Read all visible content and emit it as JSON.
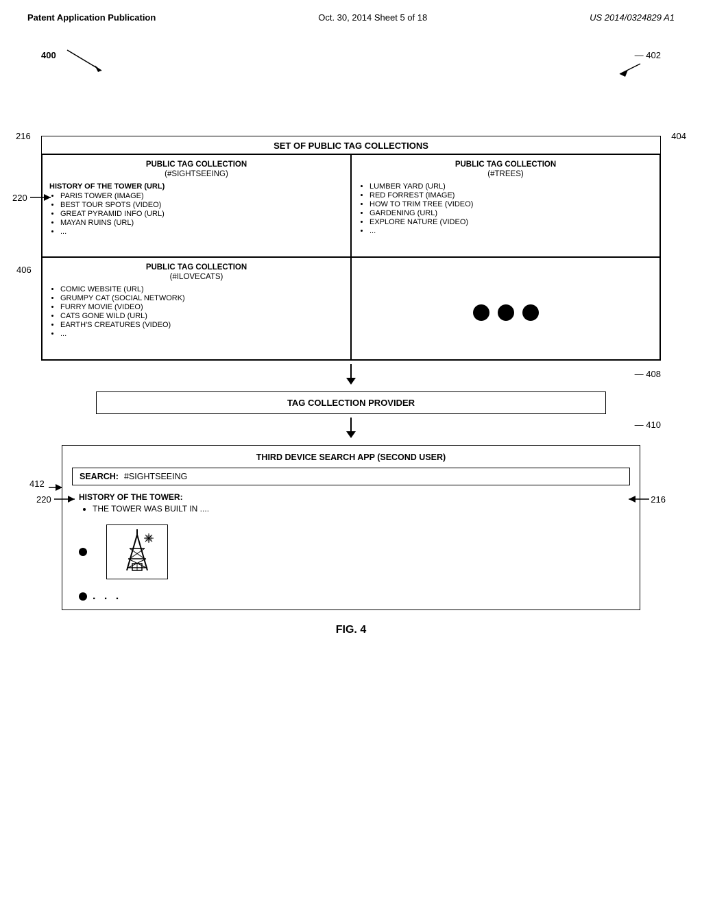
{
  "header": {
    "left": "Patent Application Publication",
    "center": "Oct. 30, 2014   Sheet 5 of 18",
    "right": "US 2014/0324829 A1"
  },
  "diagram": {
    "label_400": "400",
    "label_402": "402",
    "label_216_outer": "216",
    "label_404": "404",
    "label_406": "406",
    "label_408": "408",
    "label_410": "410",
    "label_412": "412",
    "label_220_result": "220",
    "label_216_result": "216",
    "outer_box_title": "SET OF PUBLIC TAG COLLECTIONS",
    "tag_collection_1": {
      "title": "PUBLIC TAG COLLECTION",
      "subtitle": "(#SIGHTSEEING)",
      "label_220": "220",
      "first_item": "HISTORY OF THE TOWER (URL)",
      "items": [
        "PARIS TOWER (IMAGE)",
        "BEST TOUR SPOTS (VIDEO)",
        "GREAT PYRAMID INFO (URL)",
        "MAYAN RUINS (URL)",
        "..."
      ]
    },
    "tag_collection_2": {
      "title": "PUBLIC TAG COLLECTION",
      "subtitle": "(#TREES)",
      "items": [
        "LUMBER YARD (URL)",
        "RED FORREST (IMAGE)",
        "HOW TO TRIM TREE (VIDEO)",
        "GARDENING (URL)",
        "EXPLORE NATURE (VIDEO)",
        "..."
      ]
    },
    "tag_collection_3": {
      "title": "PUBLIC TAG COLLECTION",
      "subtitle": "(#ILOVECATS)",
      "items": [
        "COMIC WEBSITE (URL)",
        "GRUMPY CAT (SOCIAL NETWORK)",
        "FURRY MOVIE (VIDEO)",
        "CATS GONE WILD (URL)",
        "EARTH'S CREATURES (VIDEO)",
        "..."
      ]
    },
    "provider_box_title": "TAG COLLECTION PROVIDER",
    "search_app_title": "THIRD DEVICE SEARCH APP (SECOND USER)",
    "search_label": "SEARCH:",
    "search_value": "#SIGHTSEEING",
    "result_title": "HISTORY OF THE TOWER:",
    "result_item_1": "THE TOWER WAS BUILT IN ....",
    "fig_label": "FIG. 4"
  }
}
